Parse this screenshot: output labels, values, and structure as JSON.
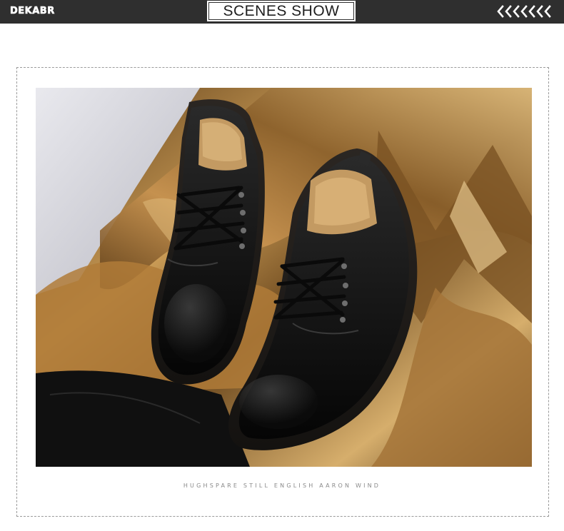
{
  "header": {
    "logo_text": "DEKABR",
    "title": "SCENES SHOW",
    "chevron_icon": "double-left-chevrons-icon"
  },
  "photo": {
    "subject": "product-photo",
    "caption": "HUGHSPARE STILL ENGLISH AARON WIND"
  },
  "colors": {
    "bar": "#2f2f2f",
    "accent": "#d11a1a",
    "fur_gold": "#b8873f",
    "shoe_black": "#121212"
  }
}
